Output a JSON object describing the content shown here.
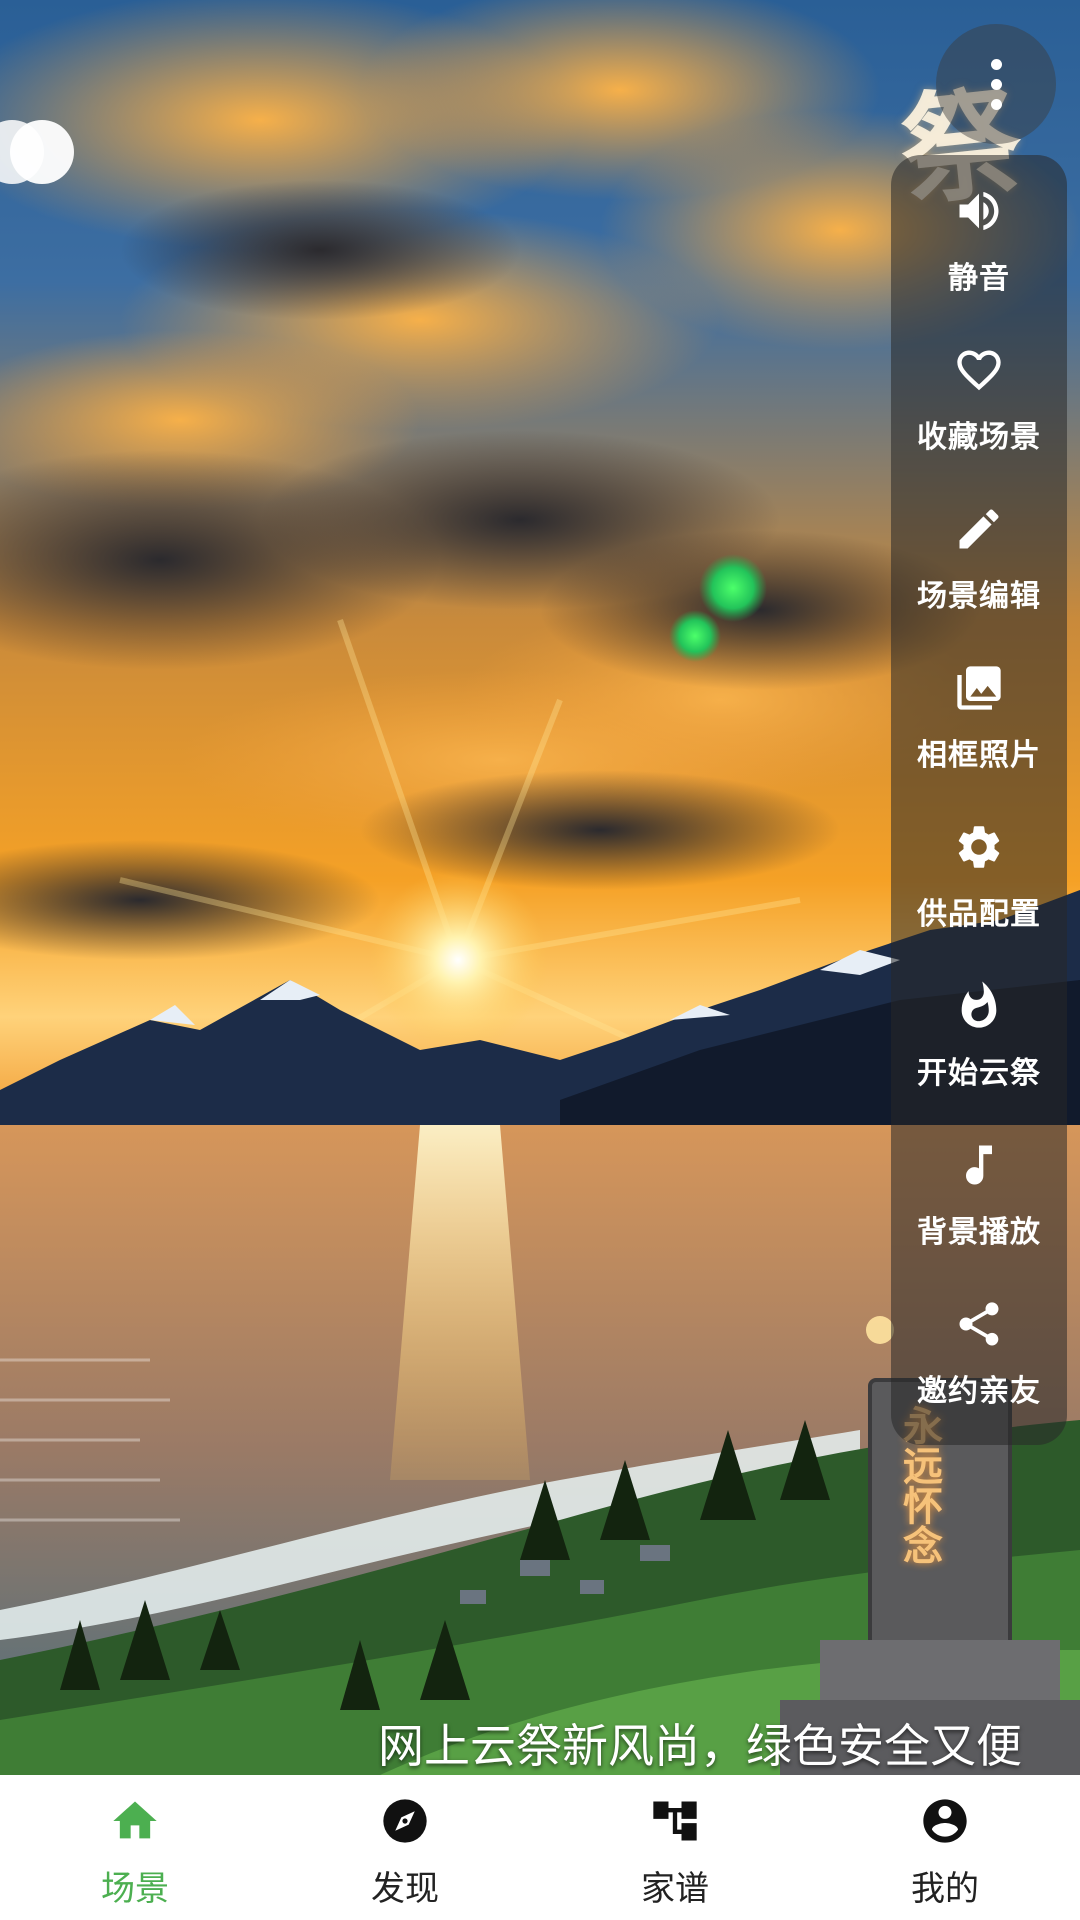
{
  "scene": {
    "glyph": "祭",
    "stone_text": "永远怀念",
    "slogan": "网上云祭新风尚，绿色安全又便"
  },
  "more_button_icon": "more-vertical-icon",
  "side_panel": {
    "items": [
      {
        "icon": "volume-icon",
        "label": "静音"
      },
      {
        "icon": "heart-icon",
        "label": "收藏场景"
      },
      {
        "icon": "pencil-icon",
        "label": "场景编辑"
      },
      {
        "icon": "image-icon",
        "label": "相框照片"
      },
      {
        "icon": "gear-icon",
        "label": "供品配置"
      },
      {
        "icon": "flame-icon",
        "label": "开始云祭"
      },
      {
        "icon": "music-note-icon",
        "label": "背景播放"
      },
      {
        "icon": "share-icon",
        "label": "邀约亲友"
      }
    ]
  },
  "bottom_nav": {
    "items": [
      {
        "icon": "home-icon",
        "label": "场景",
        "active": true
      },
      {
        "icon": "compass-icon",
        "label": "发现",
        "active": false
      },
      {
        "icon": "family-tree-icon",
        "label": "家谱",
        "active": false
      },
      {
        "icon": "account-icon",
        "label": "我的",
        "active": false
      }
    ]
  },
  "colors": {
    "accent": "#4caf50",
    "nav_text": "#222222",
    "panel_bg": "rgba(40,40,40,0.55)"
  }
}
